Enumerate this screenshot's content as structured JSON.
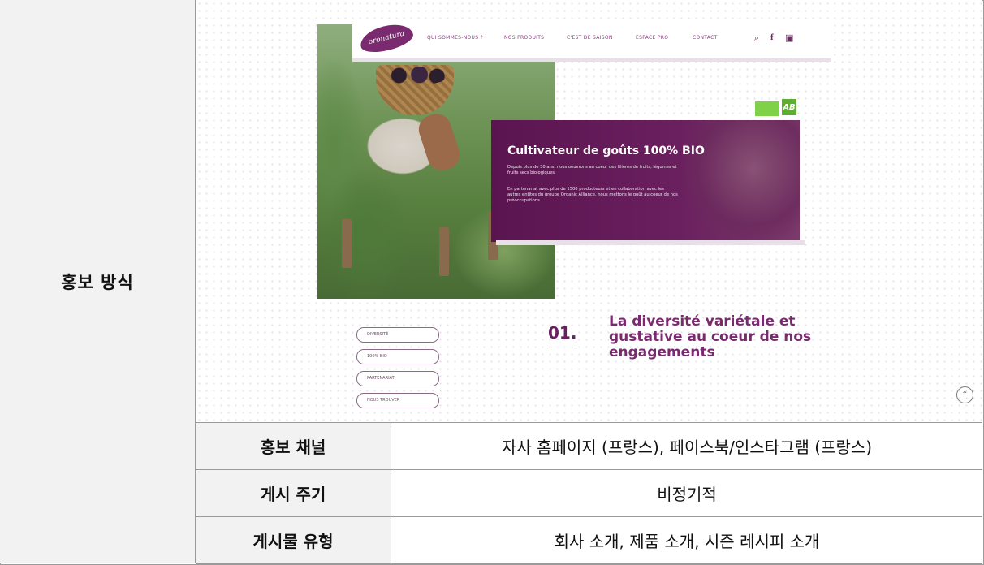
{
  "promo_label": "홍보 방식",
  "screenshot": {
    "logo_text": "oronatura",
    "nav": [
      "QUI SOMMES-NOUS ?",
      "NOS PRODUITS",
      "C'EST DE SAISON",
      "ESPACE PRO",
      "CONTACT"
    ],
    "nav_icons": [
      "search-icon",
      "facebook-icon",
      "instagram-icon"
    ],
    "bio_badge_text": "AB",
    "hero_title": "Cultivateur de goûts 100% BIO",
    "hero_paragraph_1": "Depuis plus de 30 ans, nous oeuvrons au coeur des filières de fruits, légumes et fruits secs biologiques.",
    "hero_paragraph_2": "En partenariat avec plus de 1500 producteurs et en collaboration avec les autres entités du groupe Organic Alliance, nous mettons le goût au coeur de nos préoccupations.",
    "side_menu": [
      "DIVERSITÉ",
      "100% BIO",
      "PARTENARIAT",
      "NOUS TROUVER"
    ],
    "section_number": "01.",
    "section_title": "La diversité variétale et gustative au coeur de nos engagements"
  },
  "rows": [
    {
      "label": "홍보 채널",
      "value": "자사 홈페이지 (프랑스), 페이스북/인스타그램 (프랑스)"
    },
    {
      "label": "게시 주기",
      "value": "비정기적"
    },
    {
      "label": "게시물 유형",
      "value": "회사 소개, 제품 소개, 시즌 레시피 소개"
    }
  ]
}
